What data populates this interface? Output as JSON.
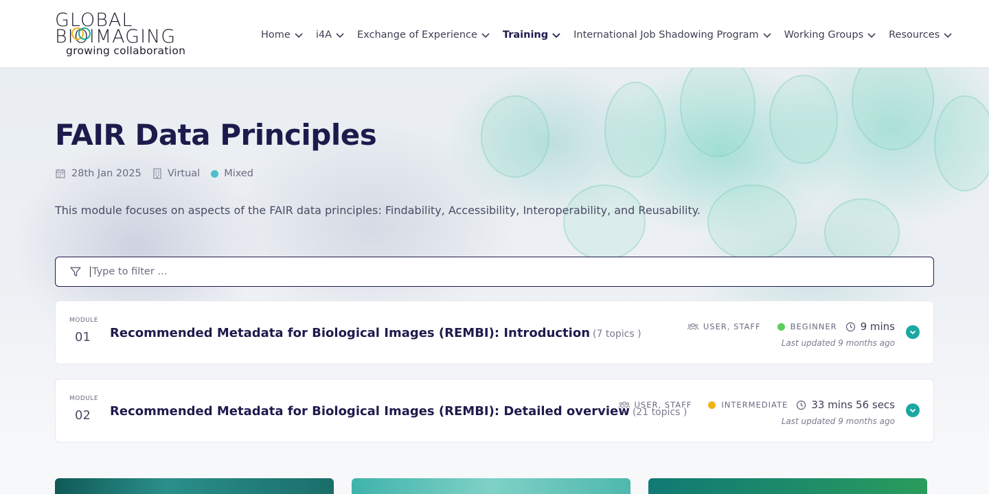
{
  "logo": {
    "line1": "GLOBAL",
    "line2": "BIOIMAGING",
    "tagline": "growing collaboration"
  },
  "nav": [
    {
      "label": "Home",
      "active": false
    },
    {
      "label": "i4A",
      "active": false
    },
    {
      "label": "Exchange of Experience",
      "active": false
    },
    {
      "label": "Training",
      "active": true
    },
    {
      "label": "International Job Shadowing Program",
      "active": false
    },
    {
      "label": "Working Groups",
      "active": false
    },
    {
      "label": "Resources",
      "active": false
    }
  ],
  "page": {
    "title": "FAIR Data Principles",
    "meta": {
      "date": "28th Jan 2025",
      "location": "Virtual",
      "format": "Mixed",
      "format_color": "#4bbdcc"
    },
    "description": "This module focuses on aspects of the FAIR data principles: Findability, Accessibility, Interoperability, and Reusability."
  },
  "filter": {
    "placeholder": "Type to filter ..."
  },
  "modules": [
    {
      "label": "MODULE",
      "number": "01",
      "title": "Recommended Metadata for Biological Images (REMBI): Introduction",
      "topics": "(7 topics )",
      "audience": "USER, STAFF",
      "level": "BEGINNER",
      "level_color": "#5ccf5c",
      "duration": "9 mins",
      "updated": "Last updated 9 months ago"
    },
    {
      "label": "MODULE",
      "number": "02",
      "title": "Recommended Metadata for Biological Images (REMBI): Detailed overview",
      "topics": "(21 topics )",
      "audience": "USER, STAFF",
      "level": "INTERMEDIATE",
      "level_color": "#f0b316",
      "duration": "33 mins 56 secs",
      "updated": "Last updated 9 months ago"
    }
  ],
  "colors": {
    "accent": "#1ba8a0",
    "navy": "#1d1b4c"
  }
}
